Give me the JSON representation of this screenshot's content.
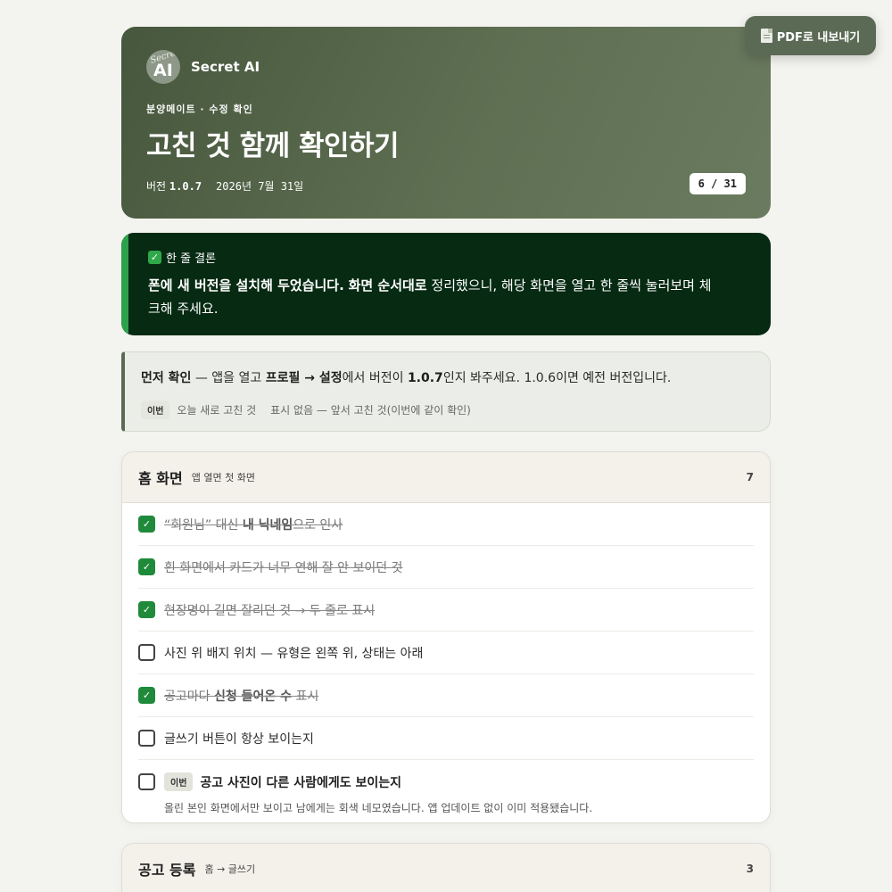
{
  "export_button": {
    "label": "PDF로 내보내기",
    "icon": "document-icon"
  },
  "hero": {
    "brand": {
      "name": "Secret AI",
      "logo_script": "Secret",
      "logo_mark": "AI"
    },
    "eyebrow": "분양메이트 · 수정 확인",
    "title": "고친 것 함께 확인하기",
    "version_label": "버전",
    "version": "1.0.7",
    "date": "2026년 7월 31일",
    "page": "6 / 31"
  },
  "conclusion": {
    "heading": "한 줄 결론",
    "bold1": "폰에 새 버전을 설치해 두었습니다.",
    "bold2": "화면 순서대로",
    "rest": "정리했으니, 해당 화면을 열고 한 줄씩 눌러보며 체크해 주세요."
  },
  "notice": {
    "lead": "먼저 확인",
    "t1": " — 앱을 열고 ",
    "path": "프로필 → 설정",
    "t2": "에서 버전이 ",
    "ver": "1.0.7",
    "t3": "인지 봐주세요. 1.0.6이면 예전 버전입니다.",
    "legend_tag": "이번",
    "legend_tag_desc": "오늘 새로 고친 것",
    "legend_plain_desc": "표시 없음 — 앞서 고친 것(이번에 같이 확인)"
  },
  "sections": [
    {
      "title": "홈 화면",
      "subtitle": "앱 열면 첫 화면",
      "count": "7",
      "items": [
        {
          "pre": "“회원님” 대신 ",
          "bold": "내 닉네임",
          "post": "으로 인사",
          "checked": true
        },
        {
          "pre": "흰 화면에서 카드가 너무 연해 잘 안 보이던 것",
          "checked": true
        },
        {
          "pre": "현장명이 길면 잘리던 것 → 두 줄로 표시",
          "checked": true
        },
        {
          "pre": "사진 위 배지 위치 — 유형은 왼쪽 위, 상태는 아래",
          "checked": false
        },
        {
          "pre": "공고마다 ",
          "bold": "신청 들어온 수",
          "post": " 표시",
          "checked": true
        },
        {
          "pre": "글쓰기 버튼이 항상 보이는지",
          "checked": false
        },
        {
          "tag": "이번",
          "title": "공고 사진이 다른 사람에게도 보이는지",
          "desc": "올린 본인 화면에서만 보이고 남에게는 회색 네모였습니다. 앱 업데이트 없이 이미 적용됐습니다.",
          "checked": false
        }
      ]
    },
    {
      "title": "공고 등록",
      "subtitle": "홈 → 글쓰기",
      "count": "3"
    }
  ],
  "colors": {
    "accent": "#2da14a",
    "hero": "#5b6a55",
    "conclusion_bg": "#062a12",
    "check": "#1f8a3b"
  }
}
